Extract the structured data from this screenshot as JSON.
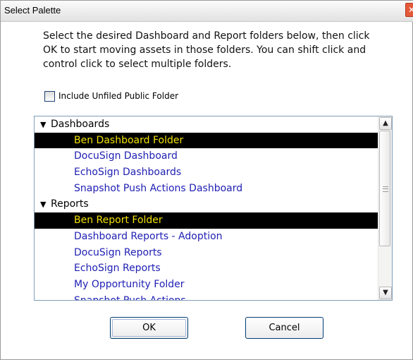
{
  "window": {
    "title": "Select Palette",
    "close_glyph": "✕"
  },
  "instructions": "Select the desired Dashboard and Report folders below, then click OK to start moving assets in those folders. You can shift click and control click to select multiple folders.",
  "include_unfiled": {
    "label": "Include Unfiled Public Folder",
    "checked": false
  },
  "tree": {
    "dashboards": {
      "label": "Dashboards",
      "items": [
        {
          "label": "Ben Dashboard Folder",
          "selected": true
        },
        {
          "label": "DocuSign Dashboard",
          "selected": false
        },
        {
          "label": "EchoSign Dashboards",
          "selected": false
        },
        {
          "label": "Snapshot Push Actions Dashboard",
          "selected": false
        }
      ]
    },
    "reports": {
      "label": "Reports",
      "items": [
        {
          "label": "Ben Report Folder",
          "selected": true
        },
        {
          "label": "Dashboard Reports - Adoption",
          "selected": false
        },
        {
          "label": "DocuSign Reports",
          "selected": false
        },
        {
          "label": "EchoSign Reports",
          "selected": false
        },
        {
          "label": "My Opportunity Folder",
          "selected": false
        },
        {
          "label": "Snapshot Push Actions",
          "selected": false
        }
      ]
    }
  },
  "buttons": {
    "ok": "OK",
    "cancel": "Cancel"
  },
  "icons": {
    "collapse_triangle": "▼",
    "scroll_up": "▲",
    "scroll_down": "▼"
  },
  "colors": {
    "selection_bg": "#000000",
    "selection_text": "#f2e200",
    "link_text": "#1e1eb4"
  }
}
